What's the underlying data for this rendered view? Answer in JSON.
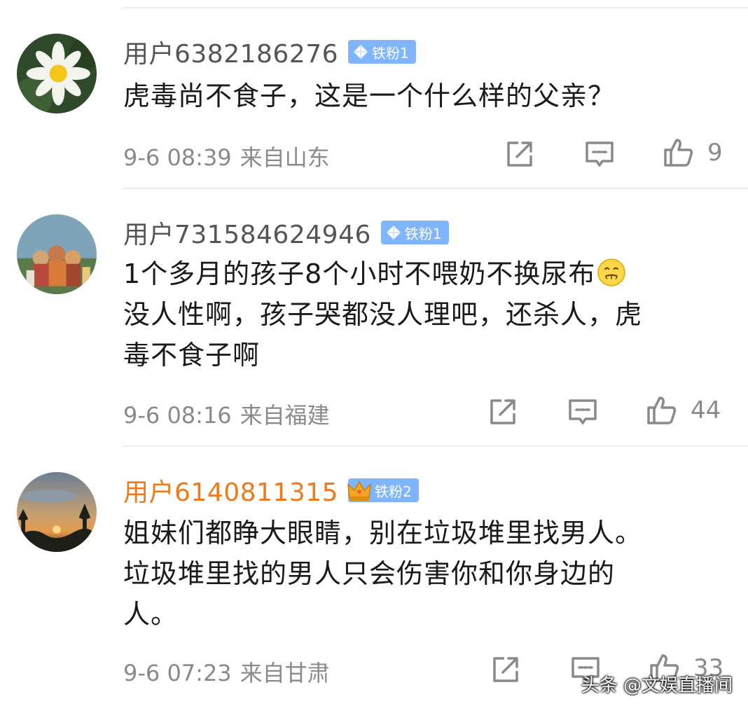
{
  "comments": [
    {
      "username": "用户6382186276",
      "badge": "铁粉1",
      "text_lines": [
        "虎毒尚不食子，这是一个什么样的父亲？"
      ],
      "time": "9-6 08:39",
      "location": "来自山东",
      "likes": "9",
      "avatar_icon": "water-lily-avatar"
    },
    {
      "username": "用户731584624946",
      "badge": "铁粉1",
      "text_lines": [
        "1个多月的孩子8个小时不喂奶不换尿布",
        "没人性啊，孩子哭都没人理吧，还杀人，虎",
        "毒不食子啊"
      ],
      "emoji_icon": "awkward-smile-emoji",
      "time": "9-6 08:16",
      "location": "来自福建",
      "likes": "44",
      "avatar_icon": "group-photo-avatar"
    },
    {
      "username": "用户6140811315",
      "badge": "铁粉2",
      "text_lines": [
        "姐妹们都睁大眼睛，别在垃圾堆里找男人。",
        "垃圾堆里找的男人只会伤害你和你身边的",
        "人。"
      ],
      "time": "9-6 07:23",
      "location": "来自甘肃",
      "likes": "33",
      "avatar_icon": "sunset-avatar"
    }
  ],
  "watermark": "头条 @文娱直播间",
  "colors": {
    "vip_username": "#ef7a1c",
    "badge_bg": "#7fb5ff",
    "meta_gray": "#8a8a8a"
  }
}
